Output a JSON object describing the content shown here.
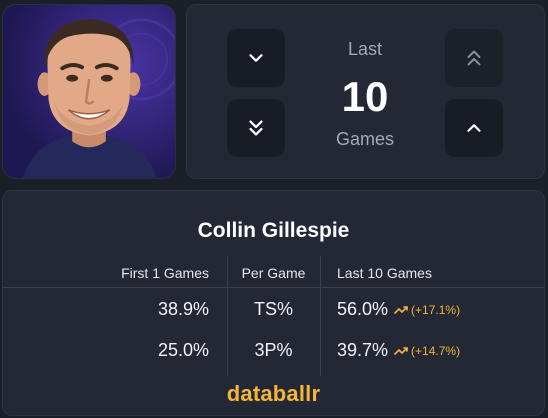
{
  "player": {
    "name": "Collin Gillespie",
    "photo_icon": "player-headshot"
  },
  "range": {
    "top_label": "Last",
    "value": "10",
    "bottom_label": "Games",
    "buttons": {
      "decrement_icon": "chevron-down-icon",
      "decrement_more_icon": "double-chevron-down-icon",
      "increment_more_icon": "double-chevron-up-icon",
      "increment_icon": "chevron-up-icon"
    }
  },
  "stats": {
    "headers": {
      "first": "First 1 Games",
      "per": "Per Game",
      "last": "Last 10 Games"
    },
    "rows": [
      {
        "first": "38.9%",
        "stat": "TS%",
        "last": "56.0%",
        "change": "(+17.1%)",
        "trend_icon": "trend-up-icon"
      },
      {
        "first": "25.0%",
        "stat": "3P%",
        "last": "39.7%",
        "change": "(+14.7%)",
        "trend_icon": "trend-up-icon"
      }
    ]
  },
  "brand": "databallr",
  "colors": {
    "accent": "#f5b53a",
    "background": "#1b1f27",
    "card": "#232834",
    "button": "#181c24"
  }
}
